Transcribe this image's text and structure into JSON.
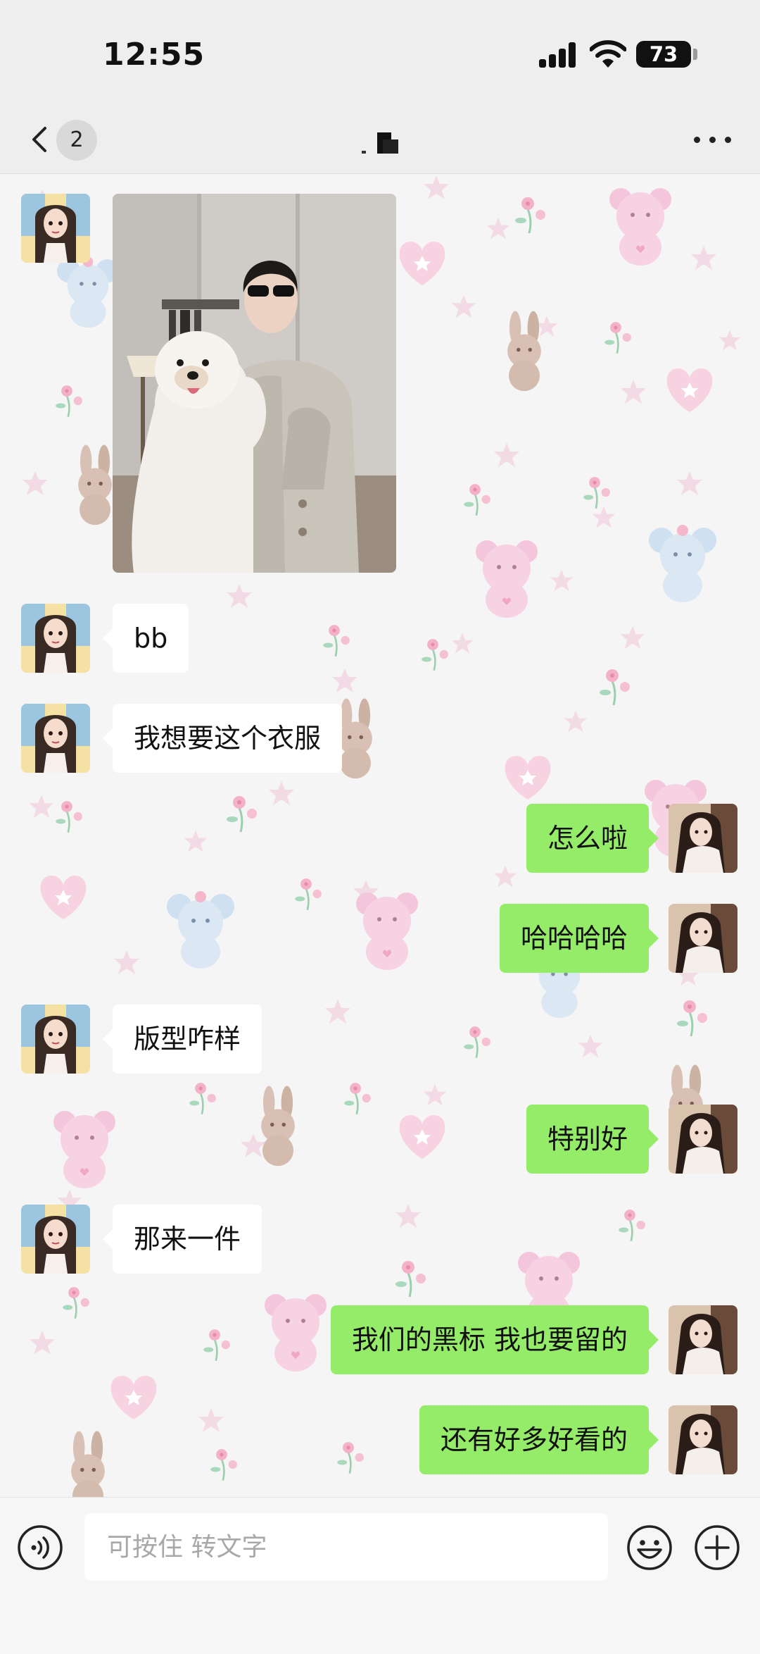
{
  "status_bar": {
    "time": "12:55",
    "battery": "73"
  },
  "nav_bar": {
    "unread_count": "2",
    "more_icon": "more-dots-icon",
    "back_icon": "chevron-left-icon"
  },
  "colors": {
    "outgoing_bubble": "#95ec69",
    "incoming_bubble": "#ffffff",
    "bar_bg": "#eeeeee"
  },
  "messages": [
    {
      "from": "contact",
      "type": "image",
      "content": "photo"
    },
    {
      "from": "contact",
      "type": "text",
      "text": "bb"
    },
    {
      "from": "contact",
      "type": "text",
      "text": "我想要这个衣服"
    },
    {
      "from": "me",
      "type": "text",
      "text": "怎么啦"
    },
    {
      "from": "me",
      "type": "text",
      "text": "哈哈哈哈"
    },
    {
      "from": "contact",
      "type": "text",
      "text": "版型咋样"
    },
    {
      "from": "me",
      "type": "text",
      "text": "特别好"
    },
    {
      "from": "contact",
      "type": "text",
      "text": "那来一件"
    },
    {
      "from": "me",
      "type": "text",
      "text": "我们的黑标 我也要留的"
    },
    {
      "from": "me",
      "type": "text",
      "text": "还有好多好看的"
    }
  ],
  "input_bar": {
    "placeholder": "可按住 转文字",
    "voice_icon": "voice-icon",
    "emoji_icon": "emoji-icon",
    "plus_icon": "plus-icon"
  }
}
